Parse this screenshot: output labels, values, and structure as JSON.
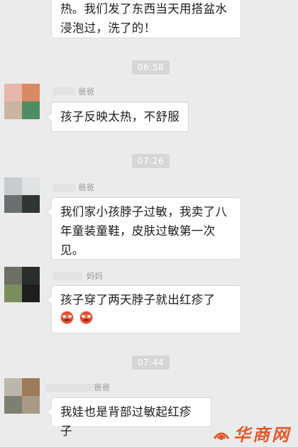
{
  "messages": [
    {
      "text": "热。我们发了东西当天用搭盆水浸泡过，洗了的！",
      "sender": "",
      "cut": true
    },
    {
      "text": "孩子反映太热，不舒服",
      "sender": "爸爸"
    },
    {
      "text": "我们家小孩脖子过敏，我卖了八年童装童鞋，皮肤过敏第一次见。",
      "sender": "爸爸"
    },
    {
      "text": "孩子穿了两天脖子就出红疹了",
      "sender": "妈妈",
      "emoji": [
        "angry-face-icon",
        "angry-face-icon"
      ]
    },
    {
      "text": "我娃也是背部过敏起红疹子",
      "sender": "爸爸"
    }
  ],
  "times": [
    "06:58",
    "07:26",
    "07:44"
  ],
  "watermark": {
    "text": "华商网",
    "color": "#e2592b"
  },
  "colors": {
    "background": "#ebebeb",
    "bubble": "#ffffff",
    "time_badge": "#d6d6d6"
  }
}
